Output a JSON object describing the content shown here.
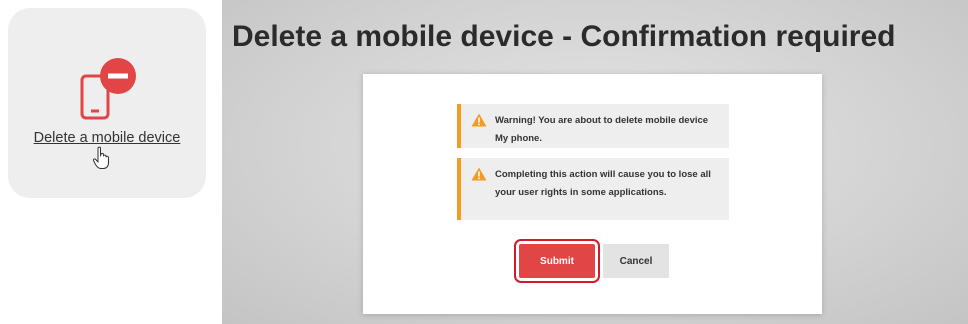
{
  "tile": {
    "icon": "mobile-device-remove-icon",
    "link_label": "Delete a mobile device",
    "cursor": "hand-pointer-icon"
  },
  "panel": {
    "title": "Delete a mobile device - Confirmation required"
  },
  "dialog": {
    "warning_1": "Warning! You are about to delete mobile device My phone.",
    "warning_2": "Completing this action will cause you to lose all your user rights in some applications.",
    "warning_icon": "warning-triangle-icon",
    "submit_label": "Submit",
    "cancel_label": "Cancel"
  },
  "colors": {
    "accent_red": "#e24545",
    "warning_orange": "#f59a23",
    "highlight_outline": "#d11a2a"
  }
}
